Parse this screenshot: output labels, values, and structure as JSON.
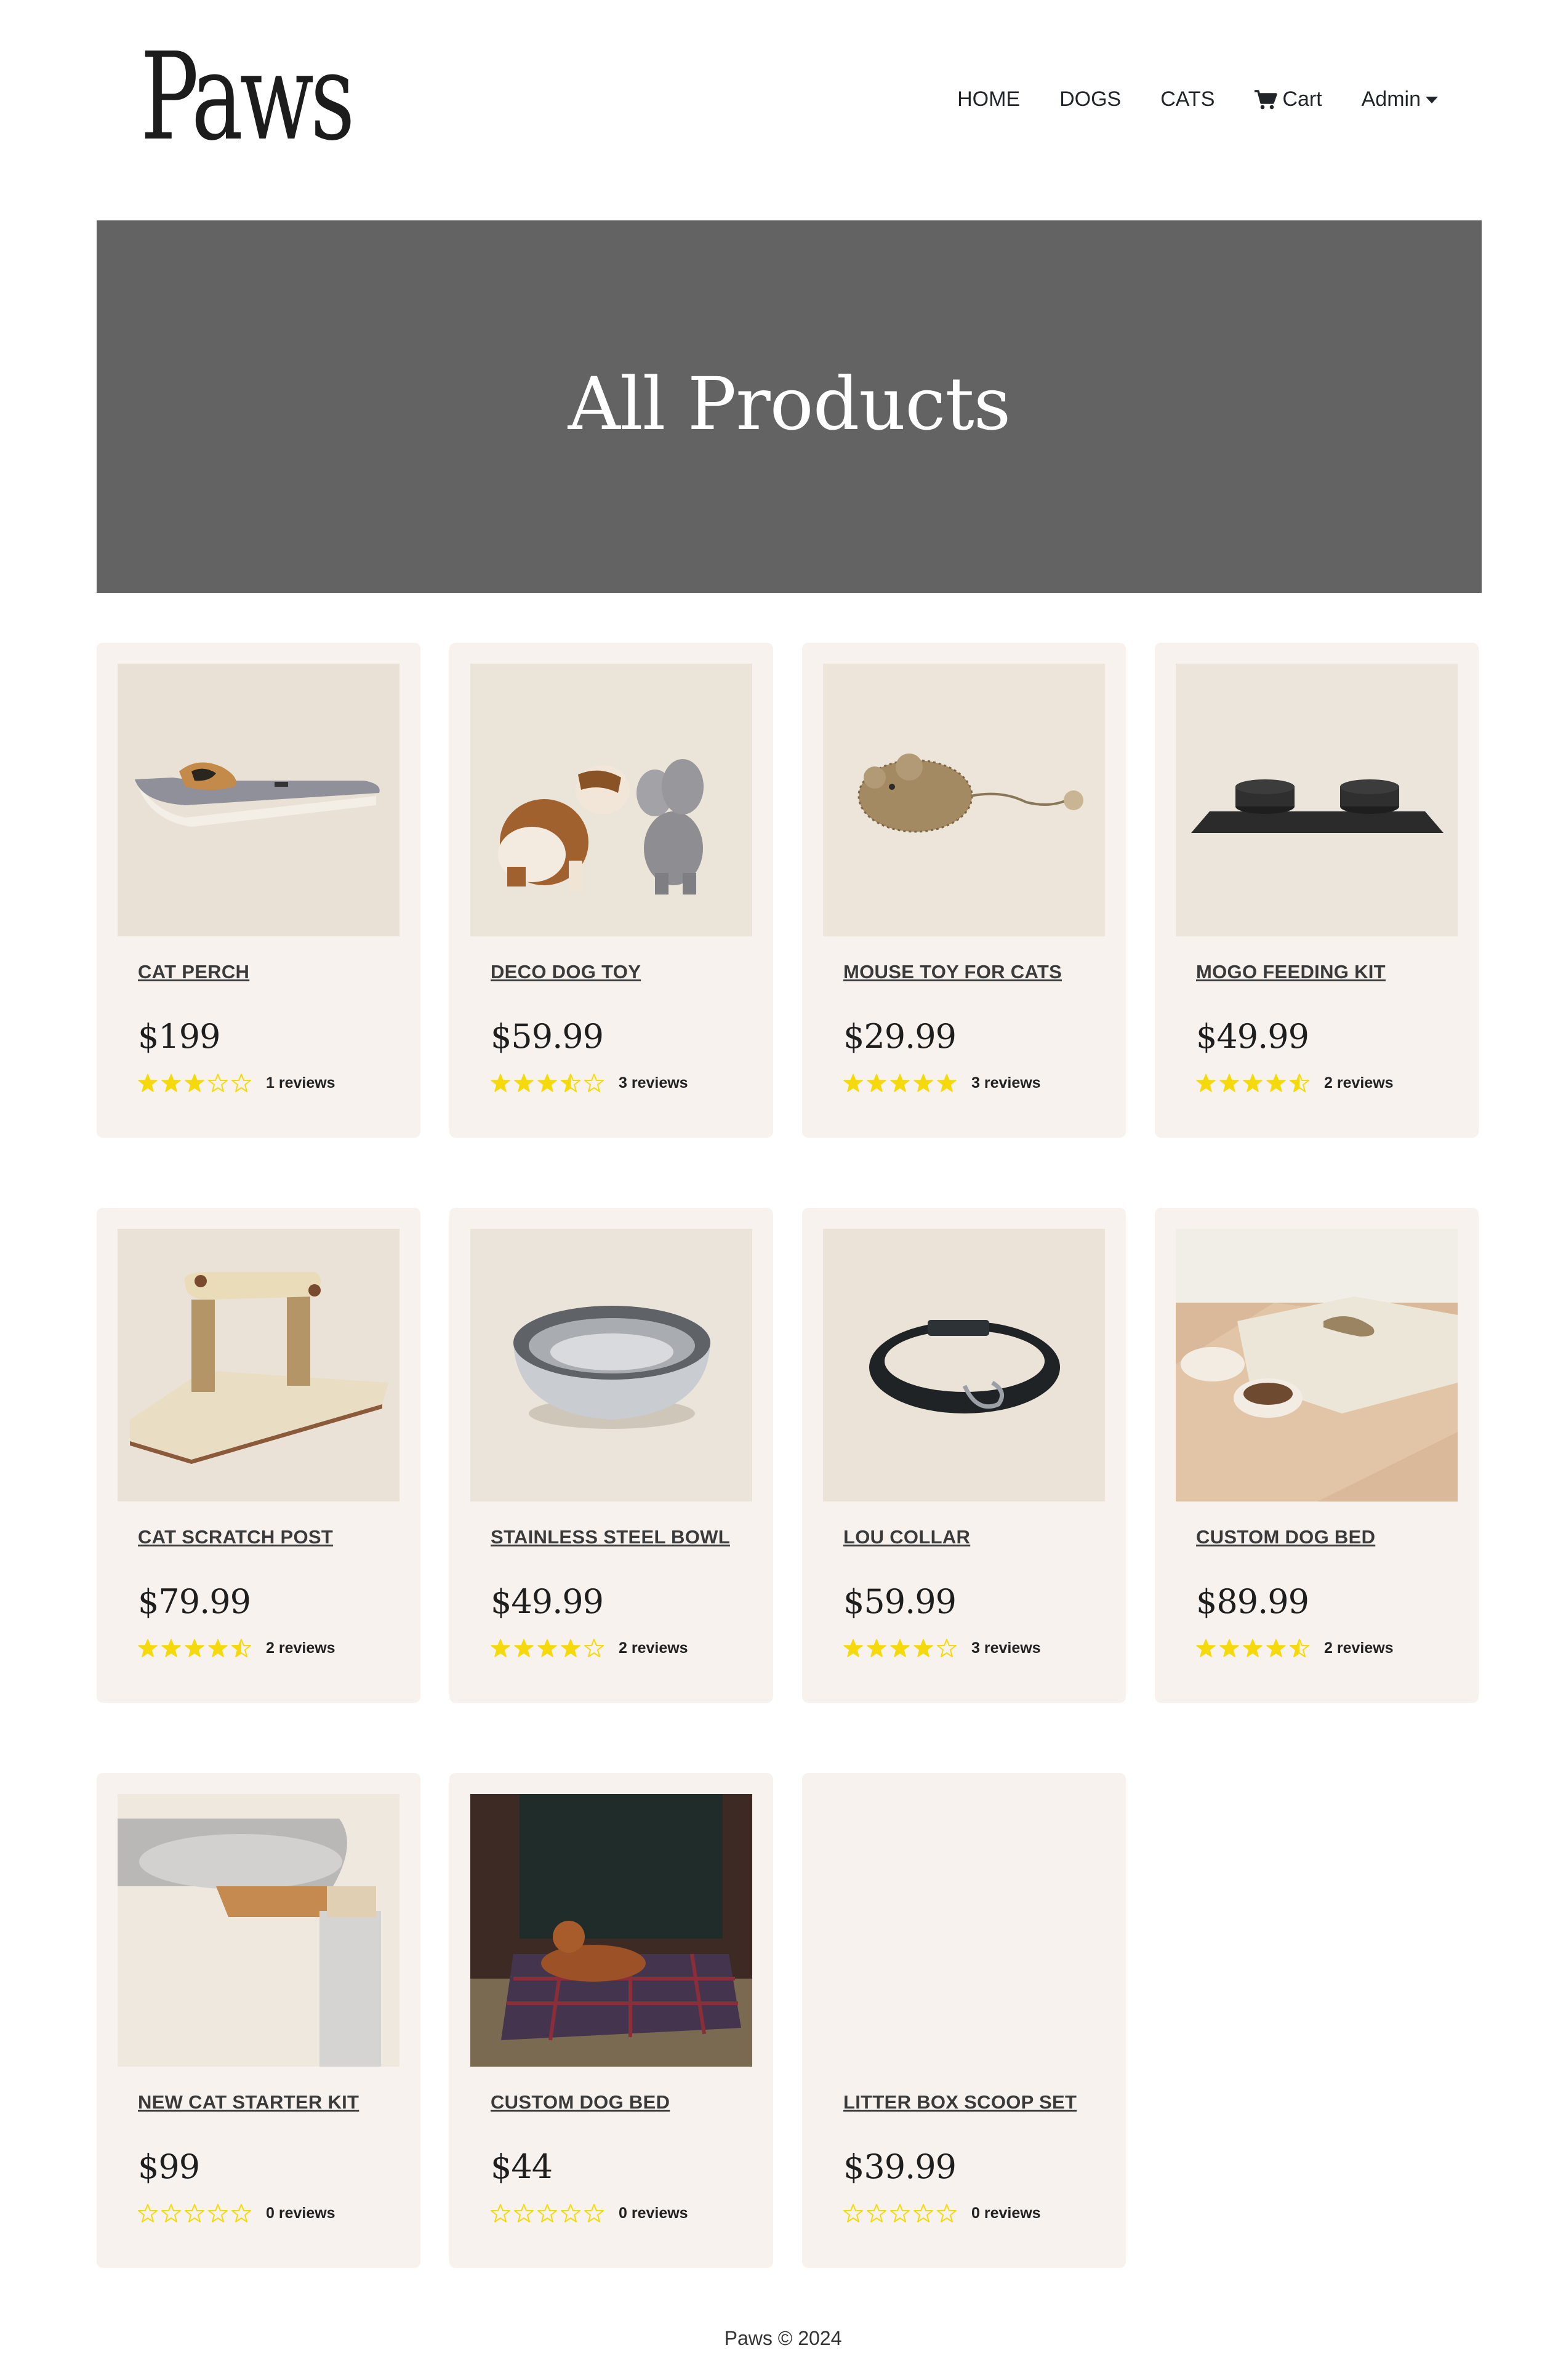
{
  "brand": {
    "logo": "Paws"
  },
  "nav": {
    "home": "HOME",
    "dogs": "DOGS",
    "cats": "CATS",
    "cart": "Cart",
    "admin": "Admin"
  },
  "hero": {
    "title": "All Products"
  },
  "colors": {
    "star": "#f5d90a",
    "hero_bg": "#636363",
    "card_bg": "#f8f2ef"
  },
  "products": [
    {
      "name": "CAT PERCH",
      "price": "$199",
      "rating": 3,
      "reviews": "1 reviews",
      "image": "cat-perch"
    },
    {
      "name": "DECO DOG TOY",
      "price": "$59.99",
      "rating": 3.5,
      "reviews": "3 reviews",
      "image": "dog-toy"
    },
    {
      "name": "MOUSE TOY FOR CATS",
      "price": "$29.99",
      "rating": 5,
      "reviews": "3 reviews",
      "image": "mouse-toy"
    },
    {
      "name": "MOGO FEEDING KIT",
      "price": "$49.99",
      "rating": 4.5,
      "reviews": "2 reviews",
      "image": "feeding-kit"
    },
    {
      "name": "CAT SCRATCH POST",
      "price": "$79.99",
      "rating": 4.5,
      "reviews": "2 reviews",
      "image": "scratch-post"
    },
    {
      "name": "STAINLESS STEEL BOWL",
      "price": "$49.99",
      "rating": 4,
      "reviews": "2 reviews",
      "image": "steel-bowl"
    },
    {
      "name": "LOU COLLAR",
      "price": "$59.99",
      "rating": 4,
      "reviews": "3 reviews",
      "image": "collar"
    },
    {
      "name": "CUSTOM DOG BED",
      "price": "$89.99",
      "rating": 4.5,
      "reviews": "2 reviews",
      "image": "dog-bed-wood"
    },
    {
      "name": "NEW CAT STARTER KIT",
      "price": "$99",
      "rating": 0,
      "reviews": "0 reviews",
      "image": "cat-starter"
    },
    {
      "name": "CUSTOM DOG BED",
      "price": "$44",
      "rating": 0,
      "reviews": "0 reviews",
      "image": "dog-bed-plaid"
    },
    {
      "name": "LITTER BOX SCOOP SET",
      "price": "$39.99",
      "rating": 0,
      "reviews": "0 reviews",
      "image": "none"
    }
  ],
  "footer": {
    "text": "Paws © 2024"
  }
}
